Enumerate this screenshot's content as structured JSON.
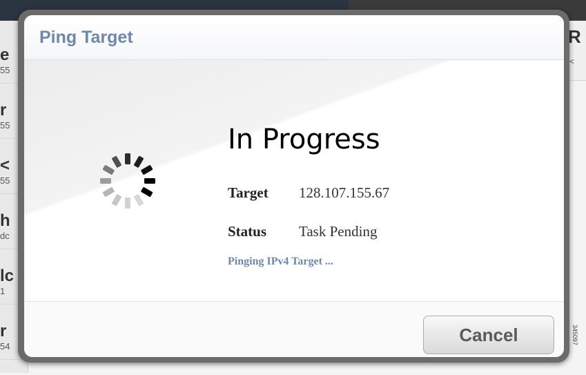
{
  "background": {
    "list_rows": [
      {
        "big": "e",
        "small": "55"
      },
      {
        "big": "r",
        "small": "55"
      },
      {
        "big": "<",
        "small": "55"
      },
      {
        "big": "h",
        "small": "dc"
      },
      {
        "big": "lc",
        "small": "1"
      },
      {
        "big": "r",
        "small": "54"
      }
    ],
    "right_panel": {
      "big": "R",
      "small": "<"
    },
    "figure_id": "345097"
  },
  "dialog": {
    "title": "Ping Target",
    "status_heading": "In Progress",
    "target_label": "Target",
    "target_value": "128.107.155.67",
    "status_label": "Status",
    "status_value": "Task Pending",
    "progress_note": "Pinging IPv4 Target ...",
    "spinner_icon": "loading-spinner-icon",
    "cancel_label": "Cancel"
  },
  "colors": {
    "title": "#6e88ab",
    "note": "#6e88ab",
    "frame": "#6b6b6b"
  }
}
